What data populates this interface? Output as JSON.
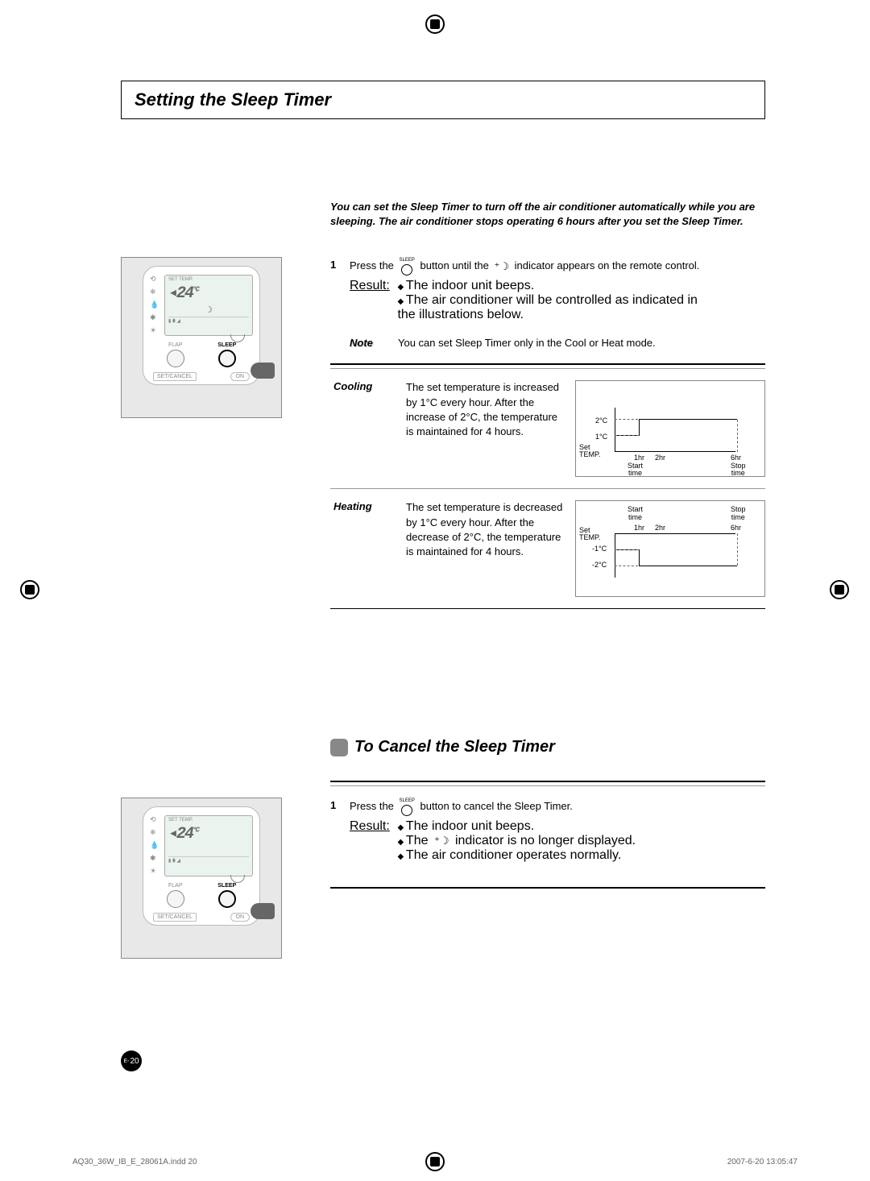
{
  "title": "Setting the Sleep Timer",
  "intro": "You can set the Sleep Timer to turn off the air conditioner automatically while you are sleeping. The air conditioner stops operating 6 hours after you set the Sleep Timer.",
  "remote": {
    "set_temp_label": "SET TEMP.",
    "temp_value": "24",
    "temp_unit": "°C",
    "flap": "FLAP",
    "sleep": "SLEEP",
    "set_cancel": "SET/CANCEL",
    "on": "ON"
  },
  "step1": {
    "num": "1",
    "pre": "Press the",
    "sleep_label": "SLEEP",
    "mid": "button until the",
    "post": "indicator appears on the remote control.",
    "result_label": "Result:",
    "result1": "The indoor unit beeps.",
    "result2": "The air conditioner will be controlled as indicated in the illustrations below."
  },
  "note": {
    "label": "Note",
    "text": "You can set Sleep Timer only in the Cool or Heat mode."
  },
  "cooling": {
    "label": "Cooling",
    "desc": "The set temperature is increased by 1°C every hour. After the increase of 2°C, the temperature is maintained for 4 hours."
  },
  "heating": {
    "label": "Heating",
    "desc": "The set temperature is decreased by 1°C every hour. After the decrease of 2°C, the temperature is maintained for 4 hours."
  },
  "chart_data": [
    {
      "type": "line",
      "title": "Cooling",
      "xlabel": "time",
      "ylabel": "Set TEMP.",
      "y_ticks": [
        "1°C",
        "2°C"
      ],
      "x_ticks": [
        "1hr",
        "2hr",
        "6hr"
      ],
      "annotations": [
        "Start time",
        "Stop time"
      ],
      "series": [
        {
          "name": "temp_offset",
          "x": [
            0,
            1,
            1,
            2,
            2,
            6
          ],
          "y": [
            0,
            0,
            1,
            1,
            2,
            2
          ]
        }
      ]
    },
    {
      "type": "line",
      "title": "Heating",
      "xlabel": "time",
      "ylabel": "Set TEMP.",
      "y_ticks": [
        "-1°C",
        "-2°C"
      ],
      "x_ticks": [
        "1hr",
        "2hr",
        "6hr"
      ],
      "annotations": [
        "Start time",
        "Stop time"
      ],
      "series": [
        {
          "name": "temp_offset",
          "x": [
            0,
            1,
            1,
            2,
            2,
            6
          ],
          "y": [
            0,
            0,
            -1,
            -1,
            -2,
            -2
          ]
        }
      ]
    }
  ],
  "chart_labels": {
    "set_temp": "Set\nTEMP.",
    "h1": "1hr",
    "h2": "2hr",
    "h6": "6hr",
    "start": "Start\ntime",
    "stop": "Stop\ntime",
    "p2c": "2°C",
    "p1c": "1°C",
    "m1c": "-1°C",
    "m2c": "-2°C"
  },
  "subtitle": "To Cancel the Sleep Timer",
  "cancel_step": {
    "num": "1",
    "pre": "Press the",
    "sleep_label": "SLEEP",
    "post": "button to cancel the Sleep Timer.",
    "result_label": "Result:",
    "result1": "The indoor unit beeps.",
    "result2": "The         indicator is no longer displayed.",
    "result2_pre": "The",
    "result2_post": "indicator is no longer displayed.",
    "result3": "The air conditioner operates normally."
  },
  "page_num_prefix": "E-",
  "page_num": "20",
  "footer_left": "AQ30_36W_IB_E_28061A.indd   20",
  "footer_right": "2007-6-20   13:05:47"
}
